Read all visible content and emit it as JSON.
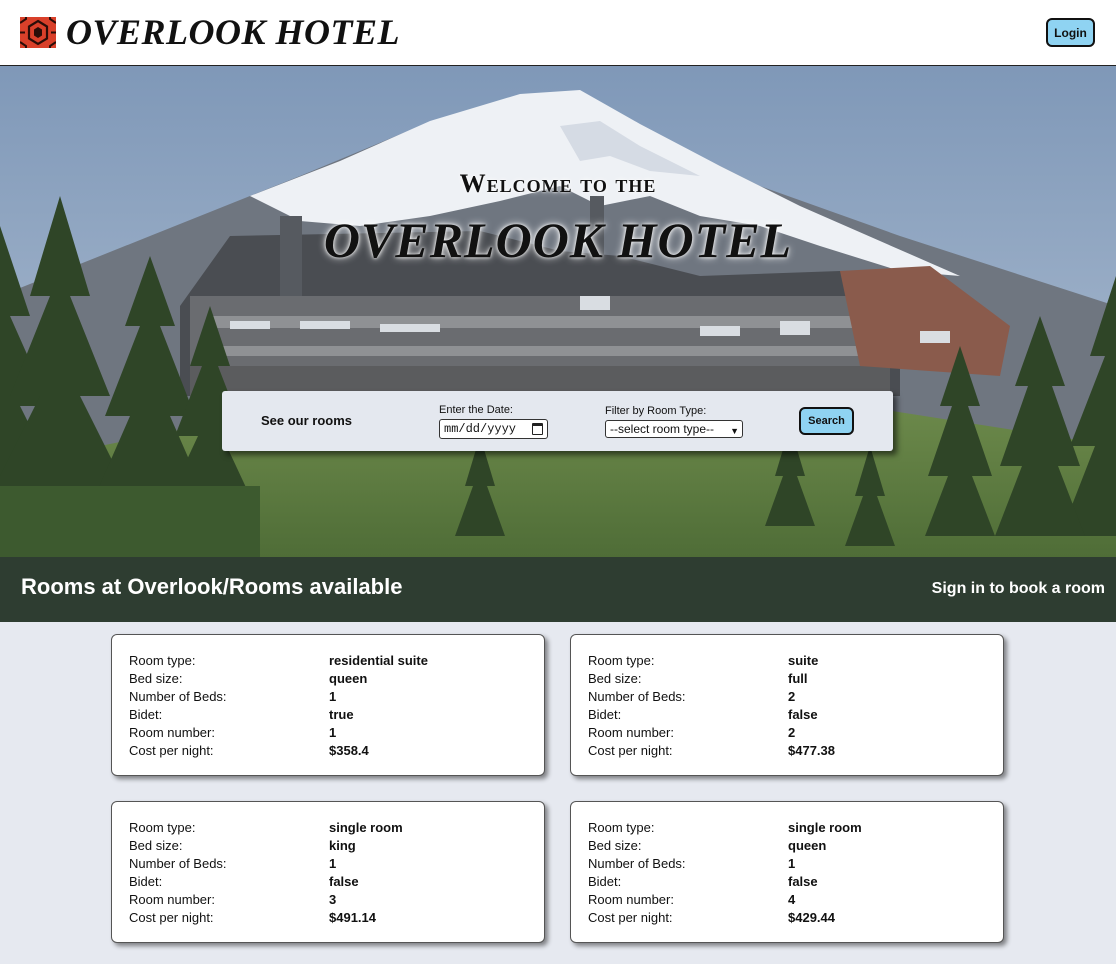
{
  "header": {
    "brand": "OVERLOOK HOTEL",
    "login_label": "Login"
  },
  "hero": {
    "welcome": "Welcome to the",
    "title": "OVERLOOK HOTEL"
  },
  "search": {
    "heading": "See our rooms",
    "date_label": "Enter the Date:",
    "date_placeholder": "mm/dd/yyyy",
    "type_label": "Filter by Room Type:",
    "type_selected": "--select room type--",
    "search_label": "Search"
  },
  "rooms_bar": {
    "heading": "Rooms at Overlook/Rooms available",
    "sign_in": "Sign in to book a room"
  },
  "field_labels": {
    "room_type": "Room type:",
    "bed_size": "Bed size:",
    "num_beds": "Number of Beds:",
    "bidet": "Bidet:",
    "room_number": "Room number:",
    "cost": "Cost per night:"
  },
  "rooms": [
    {
      "room_type": "residential suite",
      "bed_size": "queen",
      "num_beds": "1",
      "bidet": "true",
      "room_number": "1",
      "cost": "$358.4"
    },
    {
      "room_type": "suite",
      "bed_size": "full",
      "num_beds": "2",
      "bidet": "false",
      "room_number": "2",
      "cost": "$477.38"
    },
    {
      "room_type": "single room",
      "bed_size": "king",
      "num_beds": "1",
      "bidet": "false",
      "room_number": "3",
      "cost": "$491.14"
    },
    {
      "room_type": "single room",
      "bed_size": "queen",
      "num_beds": "1",
      "bidet": "false",
      "room_number": "4",
      "cost": "$429.44"
    }
  ],
  "colors": {
    "accent_button": "#8fd3f2",
    "rooms_bar": "#2e3d31",
    "page_bg": "#e6e9f0",
    "logo_red": "#d9402a"
  },
  "icons": {
    "logo": "hexagon-pattern-logo-icon",
    "date_picker": "calendar-icon",
    "select_arrow": "chevron-down-icon"
  }
}
